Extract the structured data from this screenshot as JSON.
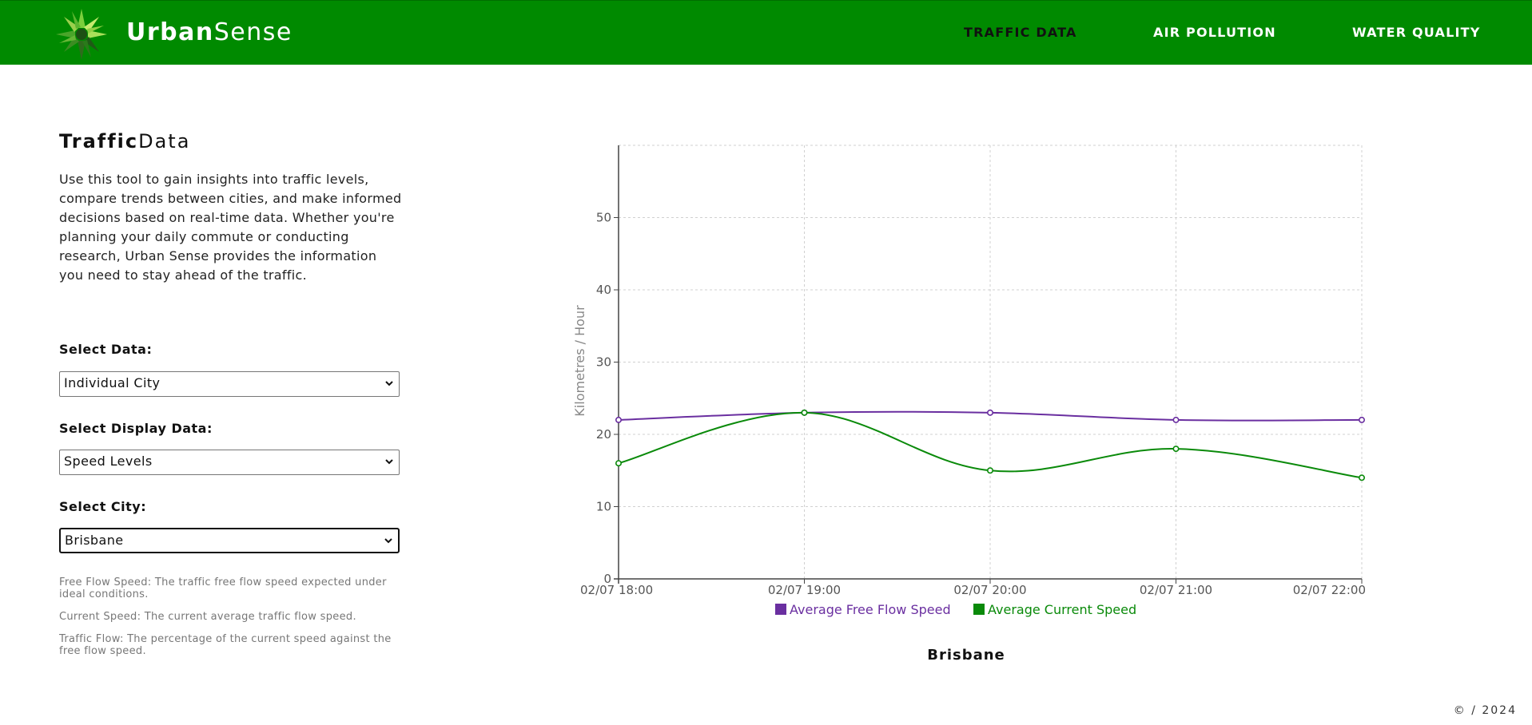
{
  "header": {
    "brand_bold": "Urban",
    "brand_light": "Sense",
    "nav": [
      "TRAFFIC DATA",
      "AIR POLLUTION",
      "WATER QUALITY"
    ],
    "active_index": 0,
    "bg_color": "#008a00"
  },
  "page": {
    "title_bold": "Traffic",
    "title_light": "Data",
    "intro": "Use this tool to gain insights into traffic levels, compare trends between cities, and make informed decisions based on real-time data. Whether you're planning your daily commute or conducting research, Urban Sense provides the information you need to stay ahead of the traffic."
  },
  "controls": {
    "select_data_label": "Select Data:",
    "select_data_value": "Individual City",
    "select_display_label": "Select Display Data:",
    "select_display_value": "Speed Levels",
    "select_city_label": "Select City:",
    "select_city_value": "Brisbane"
  },
  "notes": [
    "Free Flow Speed: The traffic free flow speed expected under ideal conditions.",
    "Current Speed: The current average traffic flow speed.",
    "Traffic Flow: The percentage of the current speed against the free flow speed."
  ],
  "chart_data": {
    "type": "line",
    "title": "Brisbane",
    "ylabel": "Kilometres / Hour",
    "xlabel": "",
    "x": [
      "02/07 18:00",
      "02/07 19:00",
      "02/07 20:00",
      "02/07 21:00",
      "02/07 22:00"
    ],
    "ylim": [
      0,
      60
    ],
    "yticks": [
      0,
      10,
      20,
      30,
      40,
      50
    ],
    "grid": true,
    "legend_position": "bottom",
    "series": [
      {
        "name": "Average Free Flow Speed",
        "color": "#6a2fa0",
        "values": [
          22,
          23,
          23,
          22,
          22
        ]
      },
      {
        "name": "Average Current Speed",
        "color": "#0a8a0a",
        "values": [
          16,
          23,
          15,
          18,
          14
        ]
      }
    ]
  },
  "footer": {
    "text": "© / 2024"
  }
}
